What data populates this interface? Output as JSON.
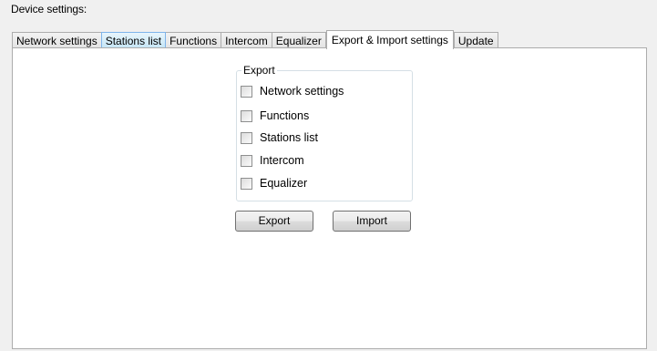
{
  "device_settings": {
    "label": "Device settings:"
  },
  "tabs": [
    {
      "label": "Network settings",
      "state": "normal"
    },
    {
      "label": "Stations list",
      "state": "hover"
    },
    {
      "label": "Functions",
      "state": "normal"
    },
    {
      "label": "Intercom",
      "state": "normal"
    },
    {
      "label": "Equalizer",
      "state": "normal"
    },
    {
      "label": "Export & Import settings",
      "state": "active"
    },
    {
      "label": "Update",
      "state": "normal"
    }
  ],
  "export_group": {
    "legend": "Export",
    "items": [
      {
        "label": "Network settings",
        "checked": false
      },
      {
        "label": "Functions",
        "checked": false
      },
      {
        "label": "Stations list",
        "checked": false
      },
      {
        "label": "Intercom",
        "checked": false
      },
      {
        "label": "Equalizer",
        "checked": false
      }
    ]
  },
  "buttons": {
    "export_label": "Export",
    "import_label": "Import"
  }
}
